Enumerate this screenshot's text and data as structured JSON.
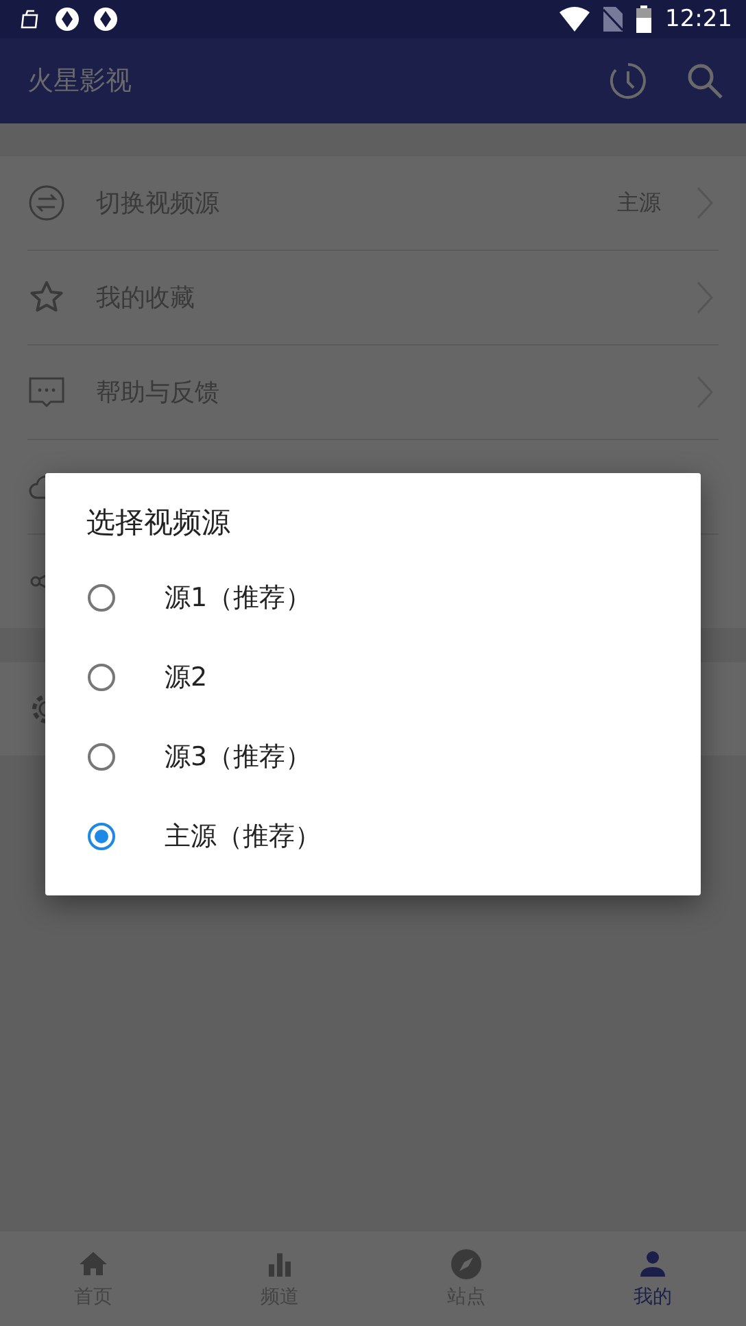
{
  "status_bar": {
    "time": "12:21"
  },
  "app_bar": {
    "title": "火星影视"
  },
  "menu": [
    {
      "kind": "switch",
      "label": "切换视频源",
      "value": "主源"
    },
    {
      "kind": "star",
      "label": "我的收藏"
    },
    {
      "kind": "chat",
      "label": "帮助与反馈"
    }
  ],
  "dialog": {
    "title": "选择视频源",
    "options": [
      {
        "label": "源1（推荐）",
        "selected": false
      },
      {
        "label": "源2",
        "selected": false
      },
      {
        "label": "源3（推荐）",
        "selected": false
      },
      {
        "label": "主源（推荐）",
        "selected": true
      }
    ]
  },
  "bottom_nav": [
    {
      "kind": "home",
      "label": "首页",
      "selected": false
    },
    {
      "kind": "chart",
      "label": "频道",
      "selected": false
    },
    {
      "kind": "compass",
      "label": "站点",
      "selected": false
    },
    {
      "kind": "person",
      "label": "我的",
      "selected": true
    }
  ]
}
